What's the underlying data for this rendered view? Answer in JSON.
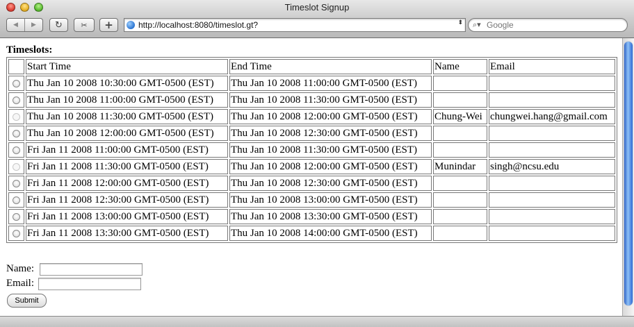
{
  "window": {
    "title": "Timeslot Signup"
  },
  "toolbar": {
    "url": "http://localhost:8080/timeslot.gt?",
    "search_placeholder": "Google",
    "back_glyph": "◀",
    "forward_glyph": "▶",
    "reload_glyph": "↻",
    "add_glyph": "+",
    "snap_glyph": "✂",
    "url_dropdown_glyph": "⬍",
    "search_glyph": "⌕▾"
  },
  "page": {
    "heading": "Timeslots:",
    "columns": [
      "",
      "Start Time",
      "End Time",
      "Name",
      "Email"
    ],
    "rows": [
      {
        "start": "Thu Jan 10 2008 10:30:00 GMT-0500 (EST)",
        "end": "Thu Jan 10 2008 11:00:00 GMT-0500 (EST)",
        "name": "",
        "email": "",
        "taken": false
      },
      {
        "start": "Thu Jan 10 2008 11:00:00 GMT-0500 (EST)",
        "end": "Thu Jan 10 2008 11:30:00 GMT-0500 (EST)",
        "name": "",
        "email": "",
        "taken": false
      },
      {
        "start": "Thu Jan 10 2008 11:30:00 GMT-0500 (EST)",
        "end": "Thu Jan 10 2008 12:00:00 GMT-0500 (EST)",
        "name": "Chung-Wei",
        "email": "chungwei.hang@gmail.com",
        "taken": true
      },
      {
        "start": "Thu Jan 10 2008 12:00:00 GMT-0500 (EST)",
        "end": "Thu Jan 10 2008 12:30:00 GMT-0500 (EST)",
        "name": "",
        "email": "",
        "taken": false
      },
      {
        "start": "Fri Jan 11 2008 11:00:00 GMT-0500 (EST)",
        "end": "Thu Jan 10 2008 11:30:00 GMT-0500 (EST)",
        "name": "",
        "email": "",
        "taken": false
      },
      {
        "start": "Fri Jan 11 2008 11:30:00 GMT-0500 (EST)",
        "end": "Thu Jan 10 2008 12:00:00 GMT-0500 (EST)",
        "name": "Munindar",
        "email": "singh@ncsu.edu",
        "taken": true
      },
      {
        "start": "Fri Jan 11 2008 12:00:00 GMT-0500 (EST)",
        "end": "Thu Jan 10 2008 12:30:00 GMT-0500 (EST)",
        "name": "",
        "email": "",
        "taken": false
      },
      {
        "start": "Fri Jan 11 2008 12:30:00 GMT-0500 (EST)",
        "end": "Thu Jan 10 2008 13:00:00 GMT-0500 (EST)",
        "name": "",
        "email": "",
        "taken": false
      },
      {
        "start": "Fri Jan 11 2008 13:00:00 GMT-0500 (EST)",
        "end": "Thu Jan 10 2008 13:30:00 GMT-0500 (EST)",
        "name": "",
        "email": "",
        "taken": false
      },
      {
        "start": "Fri Jan 11 2008 13:30:00 GMT-0500 (EST)",
        "end": "Thu Jan 10 2008 14:00:00 GMT-0500 (EST)",
        "name": "",
        "email": "",
        "taken": false
      }
    ]
  },
  "form": {
    "name_label": "Name:",
    "email_label": "Email:",
    "name_value": "",
    "email_value": "",
    "submit_label": "Submit"
  },
  "colors": {
    "scroll_thumb": "#4a8be0",
    "close": "#e0443a",
    "minimize": "#e9b42a",
    "zoom": "#5fbf35"
  }
}
